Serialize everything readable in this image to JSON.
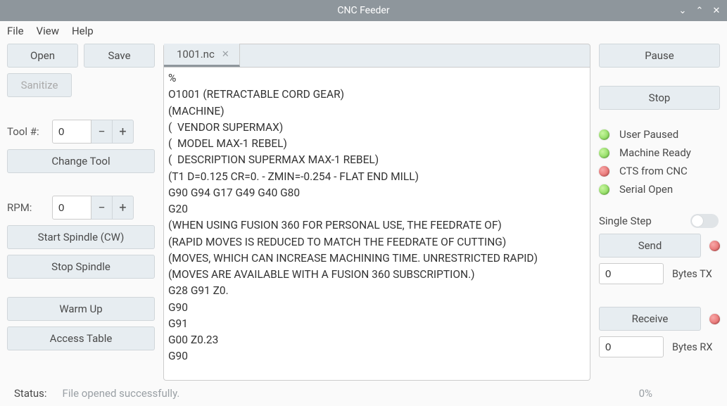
{
  "window": {
    "title": "CNC Feeder"
  },
  "menu": {
    "file": "File",
    "view": "View",
    "help": "Help"
  },
  "left": {
    "open": "Open",
    "save": "Save",
    "sanitize": "Sanitize",
    "tool_label": "Tool #:",
    "tool_value": "0",
    "change_tool": "Change Tool",
    "rpm_label": "RPM:",
    "rpm_value": "0",
    "start_spindle": "Start Spindle (CW)",
    "stop_spindle": "Stop Spindle",
    "warm_up": "Warm Up",
    "access_table": "Access Table"
  },
  "tabs": [
    {
      "label": "1001.nc"
    }
  ],
  "gcode": "%\nO1001 (RETRACTABLE CORD GEAR)\n(MACHINE)\n(  VENDOR SUPERMAX)\n(  MODEL MAX-1 REBEL)\n(  DESCRIPTION SUPERMAX MAX-1 REBEL)\n(T1 D=0.125 CR=0. - ZMIN=-0.254 - FLAT END MILL)\nG90 G94 G17 G49 G40 G80\nG20\n(WHEN USING FUSION 360 FOR PERSONAL USE, THE FEEDRATE OF)\n(RAPID MOVES IS REDUCED TO MATCH THE FEEDRATE OF CUTTING)\n(MOVES, WHICH CAN INCREASE MACHINING TIME. UNRESTRICTED RAPID)\n(MOVES ARE AVAILABLE WITH A FUSION 360 SUBSCRIPTION.)\nG28 G91 Z0.\nG90\nG91\nG00 Z0.23\nG90",
  "right": {
    "pause": "Pause",
    "stop": "Stop",
    "status": {
      "user_paused": "User Paused",
      "machine_ready": "Machine Ready",
      "cts_from_cnc": "CTS from CNC",
      "serial_open": "Serial Open"
    },
    "single_step": "Single Step",
    "send": "Send",
    "bytes_tx_label": "Bytes TX",
    "bytes_tx_value": "0",
    "receive": "Receive",
    "bytes_rx_label": "Bytes RX",
    "bytes_rx_value": "0"
  },
  "status": {
    "label": "Status:",
    "message": "File opened successfully.",
    "percent": "0%"
  },
  "glyph": {
    "minus": "−",
    "plus": "+",
    "close": "✕",
    "min": "⌄",
    "up": "⌃"
  }
}
